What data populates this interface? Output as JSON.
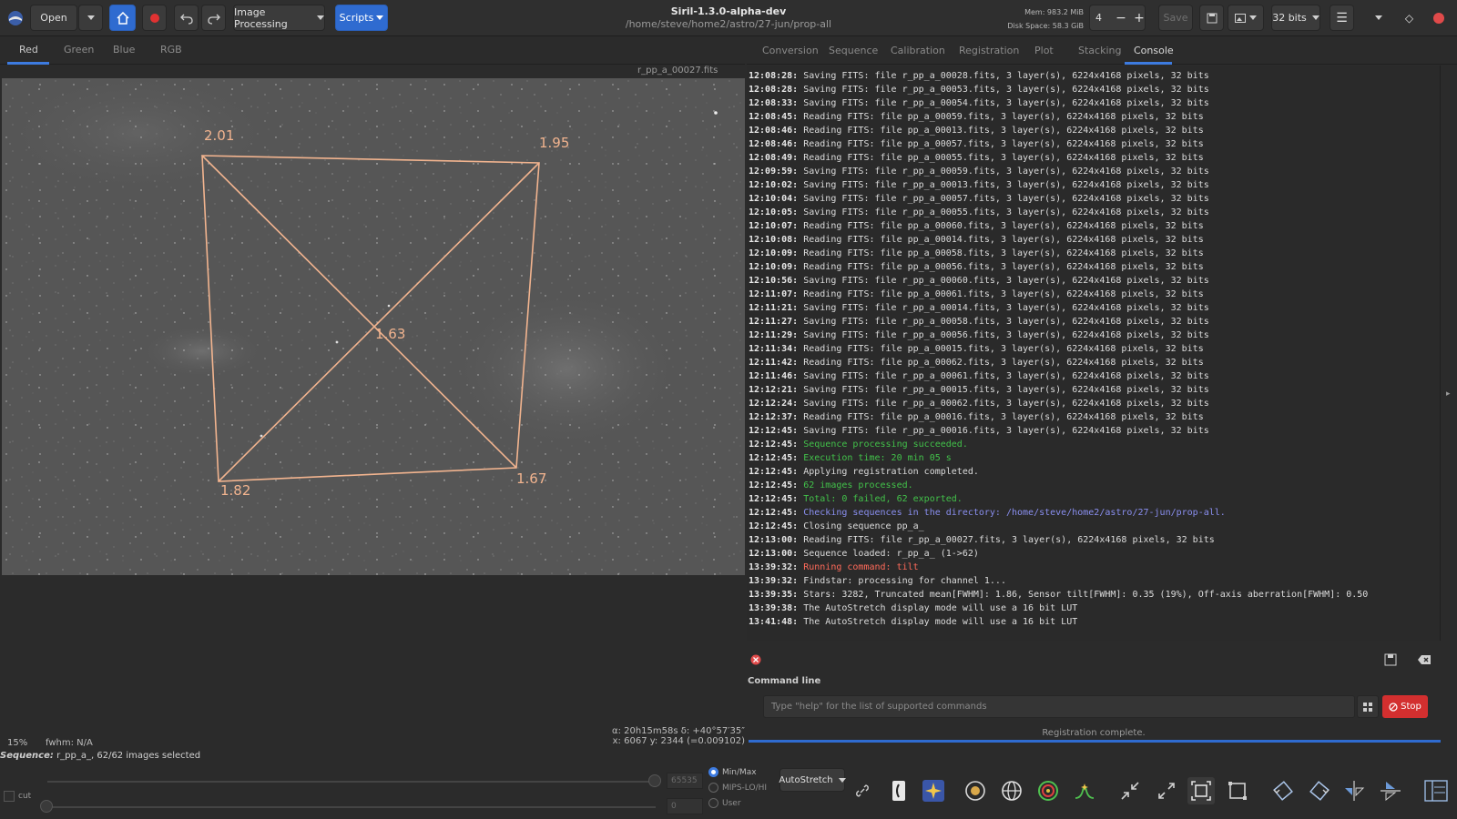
{
  "header": {
    "open_label": "Open",
    "image_processing_label": "Image Processing",
    "scripts_label": "Scripts",
    "title": "Siril-1.3.0-alpha-dev",
    "path": "/home/steve/home2/astro/27-jun/prop-all",
    "mem": "Mem: 983.2 MiB",
    "disk": "Disk Space: 58.3 GiB",
    "thread_count": "4",
    "save_label": "Save",
    "bitdepth": "32 bits"
  },
  "left": {
    "tabs": [
      "Red",
      "Green",
      "Blue",
      "RGB"
    ],
    "active_tab": "Red",
    "image_name": "r_pp_a_00027.fits",
    "corner_values": {
      "tl": "2.01",
      "tr": "1.95",
      "center": "1.63",
      "bl": "1.82",
      "br": "1.67"
    },
    "coords_radec": "α: 20h15m58s  δ: +40°57′35″",
    "coords_xy": "x: 6067  y: 2344  (=0.009102)",
    "zoom": "15%",
    "fwhm": "fwhm: N/A"
  },
  "right": {
    "tabs": [
      "Conversion",
      "Sequence",
      "Calibration",
      "Registration",
      "Plot",
      "Stacking",
      "Console"
    ],
    "active_tab": "Console",
    "log": [
      {
        "ts": "12:08:28:",
        "msg": "Saving FITS: file r_pp_a_00028.fits, 3 layer(s), 6224x4168 pixels, 32 bits",
        "kind": "normal"
      },
      {
        "ts": "12:08:28:",
        "msg": "Saving FITS: file r_pp_a_00053.fits, 3 layer(s), 6224x4168 pixels, 32 bits",
        "kind": "normal"
      },
      {
        "ts": "12:08:33:",
        "msg": "Saving FITS: file r_pp_a_00054.fits, 3 layer(s), 6224x4168 pixels, 32 bits",
        "kind": "normal"
      },
      {
        "ts": "12:08:45:",
        "msg": "Reading FITS: file pp_a_00059.fits, 3 layer(s), 6224x4168 pixels, 32 bits",
        "kind": "normal"
      },
      {
        "ts": "12:08:46:",
        "msg": "Reading FITS: file pp_a_00013.fits, 3 layer(s), 6224x4168 pixels, 32 bits",
        "kind": "normal"
      },
      {
        "ts": "12:08:46:",
        "msg": "Reading FITS: file pp_a_00057.fits, 3 layer(s), 6224x4168 pixels, 32 bits",
        "kind": "normal"
      },
      {
        "ts": "12:08:49:",
        "msg": "Reading FITS: file pp_a_00055.fits, 3 layer(s), 6224x4168 pixels, 32 bits",
        "kind": "normal"
      },
      {
        "ts": "12:09:59:",
        "msg": "Saving FITS: file r_pp_a_00059.fits, 3 layer(s), 6224x4168 pixels, 32 bits",
        "kind": "normal"
      },
      {
        "ts": "12:10:02:",
        "msg": "Saving FITS: file r_pp_a_00013.fits, 3 layer(s), 6224x4168 pixels, 32 bits",
        "kind": "normal"
      },
      {
        "ts": "12:10:04:",
        "msg": "Saving FITS: file r_pp_a_00057.fits, 3 layer(s), 6224x4168 pixels, 32 bits",
        "kind": "normal"
      },
      {
        "ts": "12:10:05:",
        "msg": "Saving FITS: file r_pp_a_00055.fits, 3 layer(s), 6224x4168 pixels, 32 bits",
        "kind": "normal"
      },
      {
        "ts": "12:10:07:",
        "msg": "Reading FITS: file pp_a_00060.fits, 3 layer(s), 6224x4168 pixels, 32 bits",
        "kind": "normal"
      },
      {
        "ts": "12:10:08:",
        "msg": "Reading FITS: file pp_a_00014.fits, 3 layer(s), 6224x4168 pixels, 32 bits",
        "kind": "normal"
      },
      {
        "ts": "12:10:09:",
        "msg": "Reading FITS: file pp_a_00058.fits, 3 layer(s), 6224x4168 pixels, 32 bits",
        "kind": "normal"
      },
      {
        "ts": "12:10:09:",
        "msg": "Reading FITS: file pp_a_00056.fits, 3 layer(s), 6224x4168 pixels, 32 bits",
        "kind": "normal"
      },
      {
        "ts": "12:10:56:",
        "msg": "Saving FITS: file r_pp_a_00060.fits, 3 layer(s), 6224x4168 pixels, 32 bits",
        "kind": "normal"
      },
      {
        "ts": "12:11:07:",
        "msg": "Reading FITS: file pp_a_00061.fits, 3 layer(s), 6224x4168 pixels, 32 bits",
        "kind": "normal"
      },
      {
        "ts": "12:11:21:",
        "msg": "Saving FITS: file r_pp_a_00014.fits, 3 layer(s), 6224x4168 pixels, 32 bits",
        "kind": "normal"
      },
      {
        "ts": "12:11:27:",
        "msg": "Saving FITS: file r_pp_a_00058.fits, 3 layer(s), 6224x4168 pixels, 32 bits",
        "kind": "normal"
      },
      {
        "ts": "12:11:29:",
        "msg": "Saving FITS: file r_pp_a_00056.fits, 3 layer(s), 6224x4168 pixels, 32 bits",
        "kind": "normal"
      },
      {
        "ts": "12:11:34:",
        "msg": "Reading FITS: file pp_a_00015.fits, 3 layer(s), 6224x4168 pixels, 32 bits",
        "kind": "normal"
      },
      {
        "ts": "12:11:42:",
        "msg": "Reading FITS: file pp_a_00062.fits, 3 layer(s), 6224x4168 pixels, 32 bits",
        "kind": "normal"
      },
      {
        "ts": "12:11:46:",
        "msg": "Saving FITS: file r_pp_a_00061.fits, 3 layer(s), 6224x4168 pixels, 32 bits",
        "kind": "normal"
      },
      {
        "ts": "12:12:21:",
        "msg": "Saving FITS: file r_pp_a_00015.fits, 3 layer(s), 6224x4168 pixels, 32 bits",
        "kind": "normal"
      },
      {
        "ts": "12:12:24:",
        "msg": "Saving FITS: file r_pp_a_00062.fits, 3 layer(s), 6224x4168 pixels, 32 bits",
        "kind": "normal"
      },
      {
        "ts": "12:12:37:",
        "msg": "Reading FITS: file pp_a_00016.fits, 3 layer(s), 6224x4168 pixels, 32 bits",
        "kind": "normal"
      },
      {
        "ts": "12:12:45:",
        "msg": "Saving FITS: file r_pp_a_00016.fits, 3 layer(s), 6224x4168 pixels, 32 bits",
        "kind": "normal"
      },
      {
        "ts": "12:12:45:",
        "msg": "Sequence processing succeeded.",
        "kind": "green"
      },
      {
        "ts": "12:12:45:",
        "msg": "Execution time: 20 min 05 s",
        "kind": "green"
      },
      {
        "ts": "12:12:45:",
        "msg": "Applying registration completed.",
        "kind": "normal"
      },
      {
        "ts": "12:12:45:",
        "msg": "62 images processed.",
        "kind": "green"
      },
      {
        "ts": "12:12:45:",
        "msg": "Total: 0 failed, 62 exported.",
        "kind": "green"
      },
      {
        "ts": "12:12:45:",
        "msg": "Checking sequences in the directory: /home/steve/home2/astro/27-jun/prop-all.",
        "kind": "blue"
      },
      {
        "ts": "12:12:45:",
        "msg": "Closing sequence pp_a_",
        "kind": "normal"
      },
      {
        "ts": "12:13:00:",
        "msg": "Reading FITS: file r_pp_a_00027.fits, 3 layer(s), 6224x4168 pixels, 32 bits",
        "kind": "normal"
      },
      {
        "ts": "12:13:00:",
        "msg": "Sequence loaded: r_pp_a_ (1->62)",
        "kind": "normal"
      },
      {
        "ts": "13:39:32:",
        "msg": "Running command: tilt",
        "kind": "red"
      },
      {
        "ts": "13:39:32:",
        "msg": "Findstar: processing for channel 1...",
        "kind": "normal"
      },
      {
        "ts": "13:39:35:",
        "msg": "Stars: 3282, Truncated mean[FWHM]: 1.86, Sensor tilt[FWHM]: 0.35 (19%), Off-axis aberration[FWHM]: 0.50",
        "kind": "normal"
      },
      {
        "ts": "13:39:38:",
        "msg": "The AutoStretch display mode will use a 16 bit LUT",
        "kind": "normal"
      },
      {
        "ts": "13:41:48:",
        "msg": "The AutoStretch display mode will use a 16 bit LUT",
        "kind": "normal"
      }
    ],
    "command_line_label": "Command line",
    "command_placeholder": "Type \"help\" for the list of supported commands",
    "stop_label": "Stop",
    "status": "Registration complete."
  },
  "bottom": {
    "sequence_label": "Sequence:",
    "sequence_value": "r_pp_a_, 62/62 images selected",
    "cut_label": "cut",
    "high_value": "65535",
    "low_value": "0",
    "radio_minmax": "Min/Max",
    "radio_mips": "MIPS-LO/HI",
    "radio_user": "User",
    "stretch_mode": "AutoStretch"
  },
  "colors": {
    "accent": "#2f6bd0",
    "stop": "#d32f2f",
    "overlay": "#f2b48f",
    "log_green": "#42c24a",
    "log_blue": "#8a8ff0",
    "log_red": "#ff6a5a"
  }
}
